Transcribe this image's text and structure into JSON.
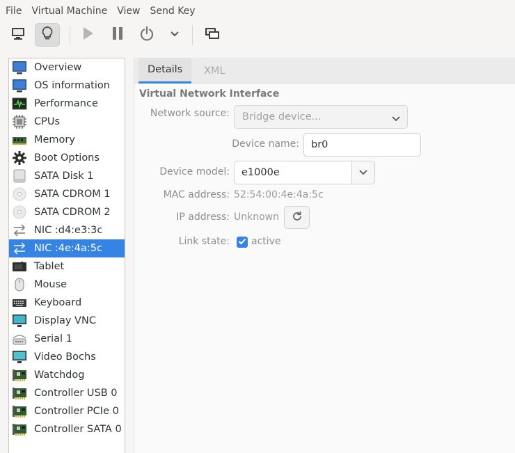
{
  "menu": [
    "File",
    "Virtual Machine",
    "View",
    "Send Key"
  ],
  "toolbar": {
    "console_icon": "monitor-icon",
    "details_icon": "lightbulb-icon",
    "run_icon": "play-icon",
    "pause_icon": "pause-icon",
    "power_icon": "power-icon",
    "power_menu_icon": "chevron-down-icon",
    "screenshot_icon": "screens-icon"
  },
  "sidebar": {
    "items": [
      {
        "label": "Overview",
        "icon": "monitor-blue-icon"
      },
      {
        "label": "OS information",
        "icon": "monitor-blue-icon"
      },
      {
        "label": "Performance",
        "icon": "performance-graph-icon"
      },
      {
        "label": "CPUs",
        "icon": "cpu-chip-icon"
      },
      {
        "label": "Memory",
        "icon": "memory-module-icon"
      },
      {
        "label": "Boot Options",
        "icon": "gear-icon"
      },
      {
        "label": "SATA Disk 1",
        "icon": "disk-drive-icon"
      },
      {
        "label": "SATA CDROM 1",
        "icon": "cdrom-icon"
      },
      {
        "label": "SATA CDROM 2",
        "icon": "cdrom-icon"
      },
      {
        "label": "NIC :d4:e3:3c",
        "icon": "network-arrows-icon"
      },
      {
        "label": "NIC :4e:4a:5c",
        "icon": "network-arrows-icon",
        "selected": true
      },
      {
        "label": "Tablet",
        "icon": "tablet-icon"
      },
      {
        "label": "Mouse",
        "icon": "mouse-icon"
      },
      {
        "label": "Keyboard",
        "icon": "keyboard-icon"
      },
      {
        "label": "Display VNC",
        "icon": "display-icon"
      },
      {
        "label": "Serial 1",
        "icon": "serial-icon"
      },
      {
        "label": "Video Bochs",
        "icon": "video-display-icon"
      },
      {
        "label": "Watchdog",
        "icon": "pci-card-icon"
      },
      {
        "label": "Controller USB 0",
        "icon": "pci-card-icon"
      },
      {
        "label": "Controller PCIe 0",
        "icon": "pci-card-icon"
      },
      {
        "label": "Controller SATA 0",
        "icon": "pci-card-icon"
      }
    ]
  },
  "tabs": {
    "details": "Details",
    "xml": "XML"
  },
  "nic": {
    "section_title": "Virtual Network Interface",
    "network_source_label": "Network source:",
    "network_source_value": "Bridge device...",
    "device_name_label": "Device name:",
    "device_name_value": "br0",
    "device_model_label": "Device model:",
    "device_model_value": "e1000e",
    "mac_label": "MAC address:",
    "mac_value": "52:54:00:4e:4a:5c",
    "ip_label": "IP address:",
    "ip_value": "Unknown",
    "link_state_label": "Link state:",
    "link_state_value": "active",
    "link_state_checked": true
  },
  "colors": {
    "accent": "#3584e4"
  }
}
